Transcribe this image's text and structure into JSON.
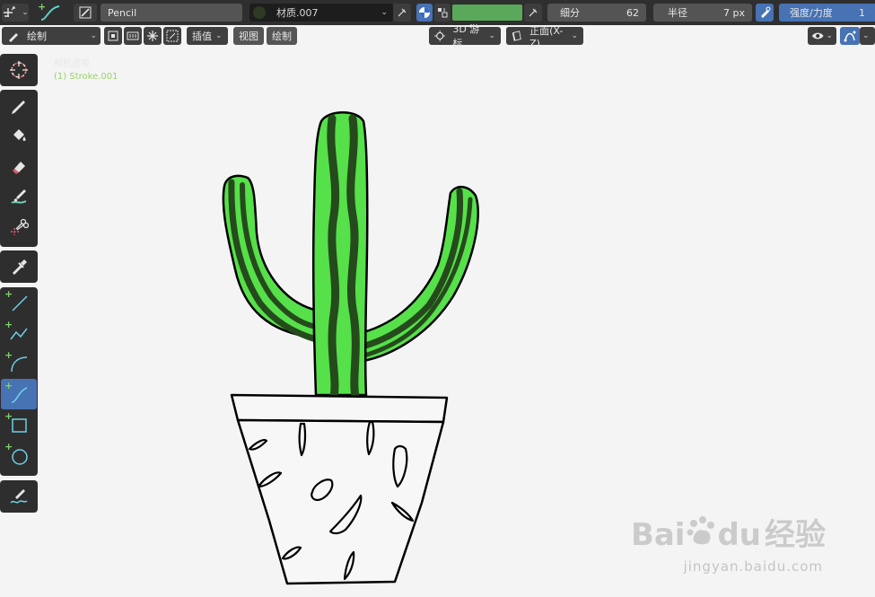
{
  "header": {
    "brush_name": "Pencil",
    "material_name": "材质.007",
    "subdivide_label": "细分",
    "subdivide_value": "62",
    "radius_label": "半径",
    "radius_value": "7 px",
    "strength_label": "强度/力度",
    "strength_value": "1",
    "color_swatch": "#5aa85a"
  },
  "row2": {
    "mode_label": "绘制",
    "interpolate_label": "插值",
    "view_label": "视图",
    "draw_label": "绘制",
    "cursor_label": "3D 游标",
    "axis_label": "正面(X-Z)"
  },
  "viewport": {
    "camera_label": "相机透视",
    "object_label": "(1) Stroke.001"
  },
  "watermark": {
    "brand": "Bai",
    "brand_mid": "du",
    "brand_cn": "经验",
    "url": "jingyan.baidu.com"
  }
}
